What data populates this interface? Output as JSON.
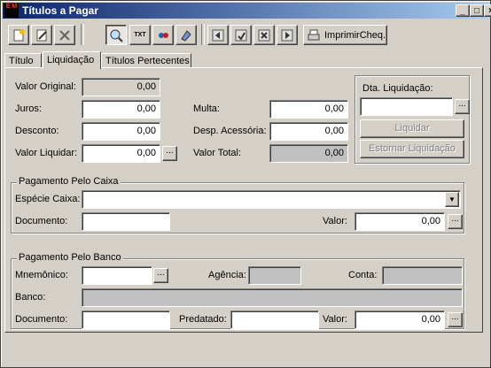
{
  "window": {
    "title": "Títulos a Pagar",
    "app_icon_text": "E M",
    "minimize": "_",
    "maximize": "□",
    "close": "×"
  },
  "toolbar": {
    "icons": [
      "new-icon",
      "edit-icon",
      "delete-icon",
      "search-icon",
      "txt-icon",
      "sort-icon",
      "copy-icon",
      "first-icon",
      "prev-icon",
      "next-icon",
      "last-icon"
    ],
    "txt_label": "TXT",
    "print_label": "ImprimirCheq."
  },
  "tabs": [
    {
      "label": "Título",
      "u": "T"
    },
    {
      "label": "Liquidação",
      "u": "L"
    },
    {
      "label": "Títulos Pertecentes",
      "u": "s"
    }
  ],
  "liquidacao": {
    "valor_original_label": "Valor Original:",
    "valor_original": "0,00",
    "juros_label": "Juros:",
    "juros": "0,00",
    "desconto_label": "Desconto:",
    "desconto": "0,00",
    "valor_liquidar_label": "Valor Liquidar:",
    "valor_liquidar": "0,00",
    "multa_label": "Multa:",
    "multa": "0,00",
    "desp_acessoria_label": "Desp. Acessória:",
    "desp_acessoria": "0,00",
    "valor_total_label": "Valor Total:",
    "valor_total": "0,00",
    "dta_liquidacao_label": "Dta. Liquidação:",
    "dta_liquidacao": "",
    "liquidar_button": "Liquidar",
    "estornar_button": "Estornar Liquidação",
    "ellipsis": "..."
  },
  "caixa": {
    "group_label": "Pagamento Pelo Caixa",
    "especie_label": "Espécie Caixa:",
    "especie_value": "",
    "documento_label": "Documento:",
    "documento": "",
    "valor_label": "Valor:",
    "valor": "0,00"
  },
  "banco": {
    "group_label": "Pagamento Pelo Banco",
    "mnemonico_label": "Mnemônico:",
    "mnemonico": "",
    "agencia_label": "Agência:",
    "agencia": "",
    "conta_label": "Conta:",
    "conta": "",
    "banco_label": "Banco:",
    "banco": "",
    "documento_label": "Documento:",
    "documento": "",
    "predatado_label": "Predatado:",
    "predatado": "",
    "valor_label": "Valor:",
    "valor": "0,00"
  }
}
